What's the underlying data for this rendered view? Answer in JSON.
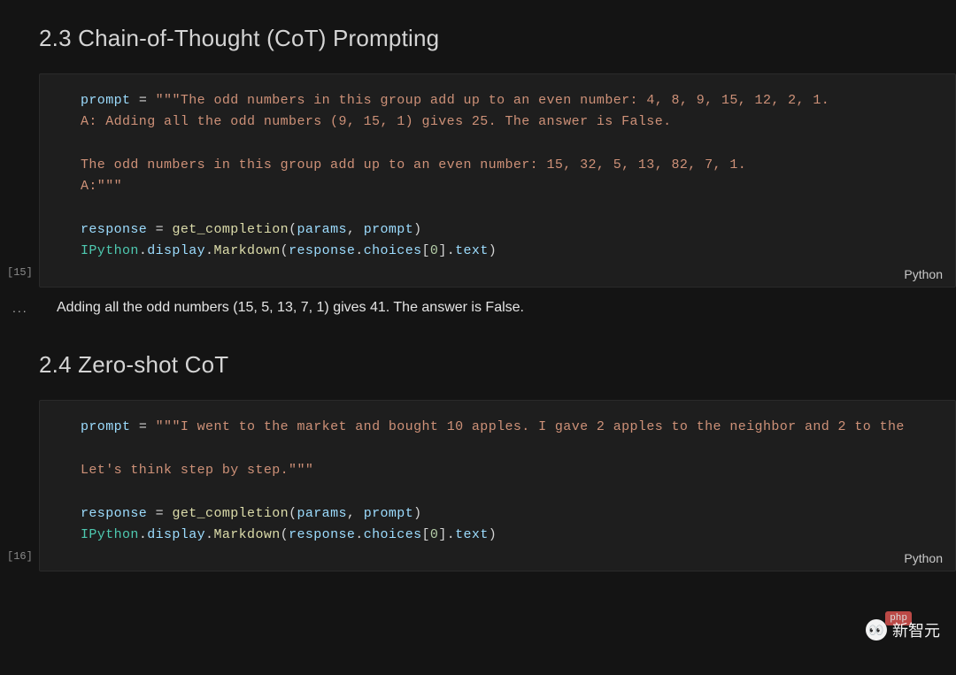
{
  "sections": [
    {
      "heading": "2.3 Chain-of-Thought (CoT) Prompting"
    },
    {
      "heading": "2.4 Zero-shot CoT"
    }
  ],
  "cells": [
    {
      "exec_count": "[15]",
      "language": "Python",
      "code": {
        "line1_var": "prompt",
        "line1_op": " = ",
        "line1_str": "\"\"\"The odd numbers in this group add up to an even number: 4, 8, 9, 15, 12, 2, 1.",
        "line2_str": "A: Adding all the odd numbers (9, 15, 1) gives 25. The answer is False.",
        "line3_str": "",
        "line4_str": "The odd numbers in this group add up to an even number: 15, 32, 5, 13, 82, 7, 1.",
        "line5_str": "A:\"\"\"",
        "line6_var": "response",
        "line6_op": " = ",
        "line6_fn": "get_completion",
        "line6_args_a": "params",
        "line6_args_b": "prompt",
        "line7_mod": "IPython",
        "line7_a": "display",
        "line7_b": "Markdown",
        "line7_arg_var": "response",
        "line7_arg_attr": "choices",
        "line7_idx": "0",
        "line7_attr2": "text"
      },
      "output_marker": "...",
      "output_text": "Adding all the odd numbers (15, 5, 13, 7, 1) gives 41. The answer is False."
    },
    {
      "exec_count": "[16]",
      "language": "Python",
      "code": {
        "line1_var": "prompt",
        "line1_op": " = ",
        "line1_str": "\"\"\"I went to the market and bought 10 apples. I gave 2 apples to the neighbor and 2 to the",
        "line2_str": "",
        "line3_str": "Let's think step by step.\"\"\"",
        "line4_var": "response",
        "line4_op": " = ",
        "line4_fn": "get_completion",
        "line4_args_a": "params",
        "line4_args_b": "prompt",
        "line5_mod": "IPython",
        "line5_a": "display",
        "line5_b": "Markdown",
        "line5_arg_var": "response",
        "line5_arg_attr": "choices",
        "line5_idx": "0",
        "line5_attr2": "text"
      }
    }
  ],
  "watermark": {
    "icon": "👀",
    "text": "新智元",
    "badge": "php"
  }
}
